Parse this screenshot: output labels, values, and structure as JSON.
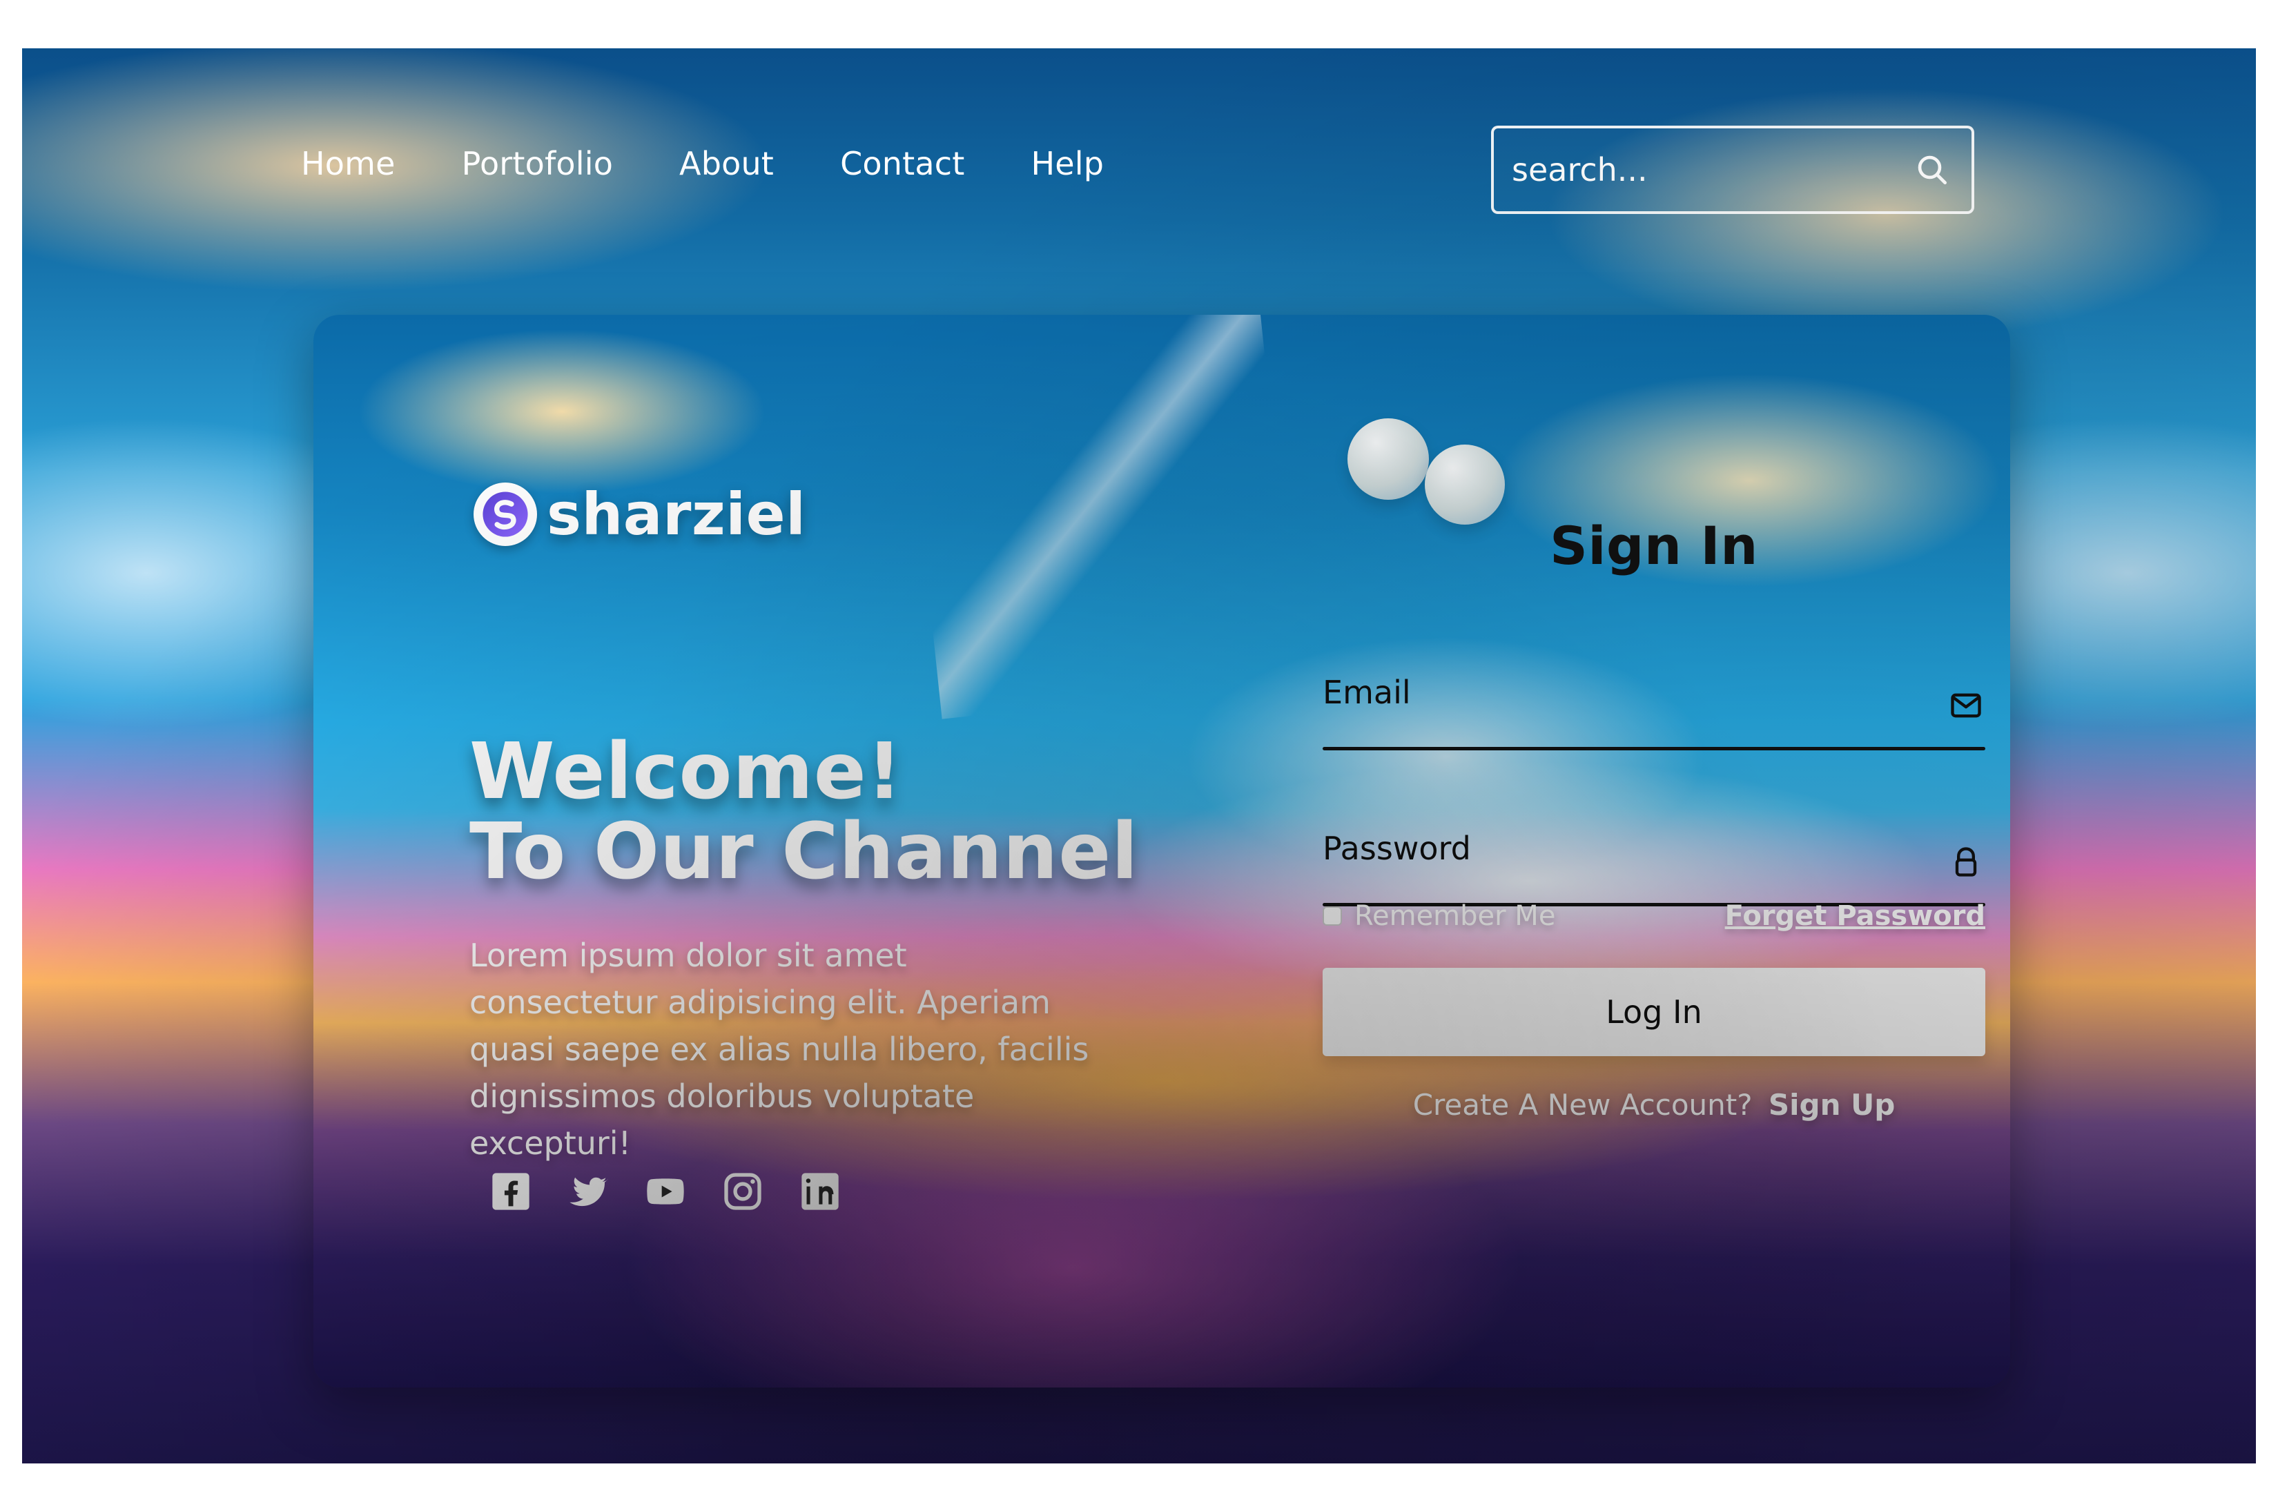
{
  "nav": {
    "links": [
      {
        "label": "Home"
      },
      {
        "label": "Portofolio"
      },
      {
        "label": "About"
      },
      {
        "label": "Contact"
      },
      {
        "label": "Help"
      }
    ],
    "search": {
      "placeholder": "search...",
      "value": ""
    }
  },
  "brand": {
    "name": "sharziel"
  },
  "hero": {
    "title_line_1": "Welcome!",
    "title_line_2": "To Our Channel",
    "description": "Lorem ipsum dolor sit amet consectetur adipisicing elit. Aperiam quasi saepe ex alias nulla libero, facilis dignissimos doloribus voluptate excepturi!"
  },
  "socials": [
    {
      "icon": "facebook-icon"
    },
    {
      "icon": "twitter-icon"
    },
    {
      "icon": "youtube-icon"
    },
    {
      "icon": "instagram-icon"
    },
    {
      "icon": "linkedin-icon"
    }
  ],
  "signin": {
    "title": "Sign In",
    "email": {
      "label": "Email",
      "value": ""
    },
    "password": {
      "label": "Password",
      "value": ""
    },
    "remember_me": "Remember Me",
    "forgot_password": "Forget Password",
    "login_button": "Log In",
    "signup_prompt": "Create A New Account?",
    "signup_link": "Sign Up"
  },
  "colors": {
    "text_on_dark": "#ffffff",
    "text_dark": "#111111",
    "button_bg": "#ffffff"
  }
}
